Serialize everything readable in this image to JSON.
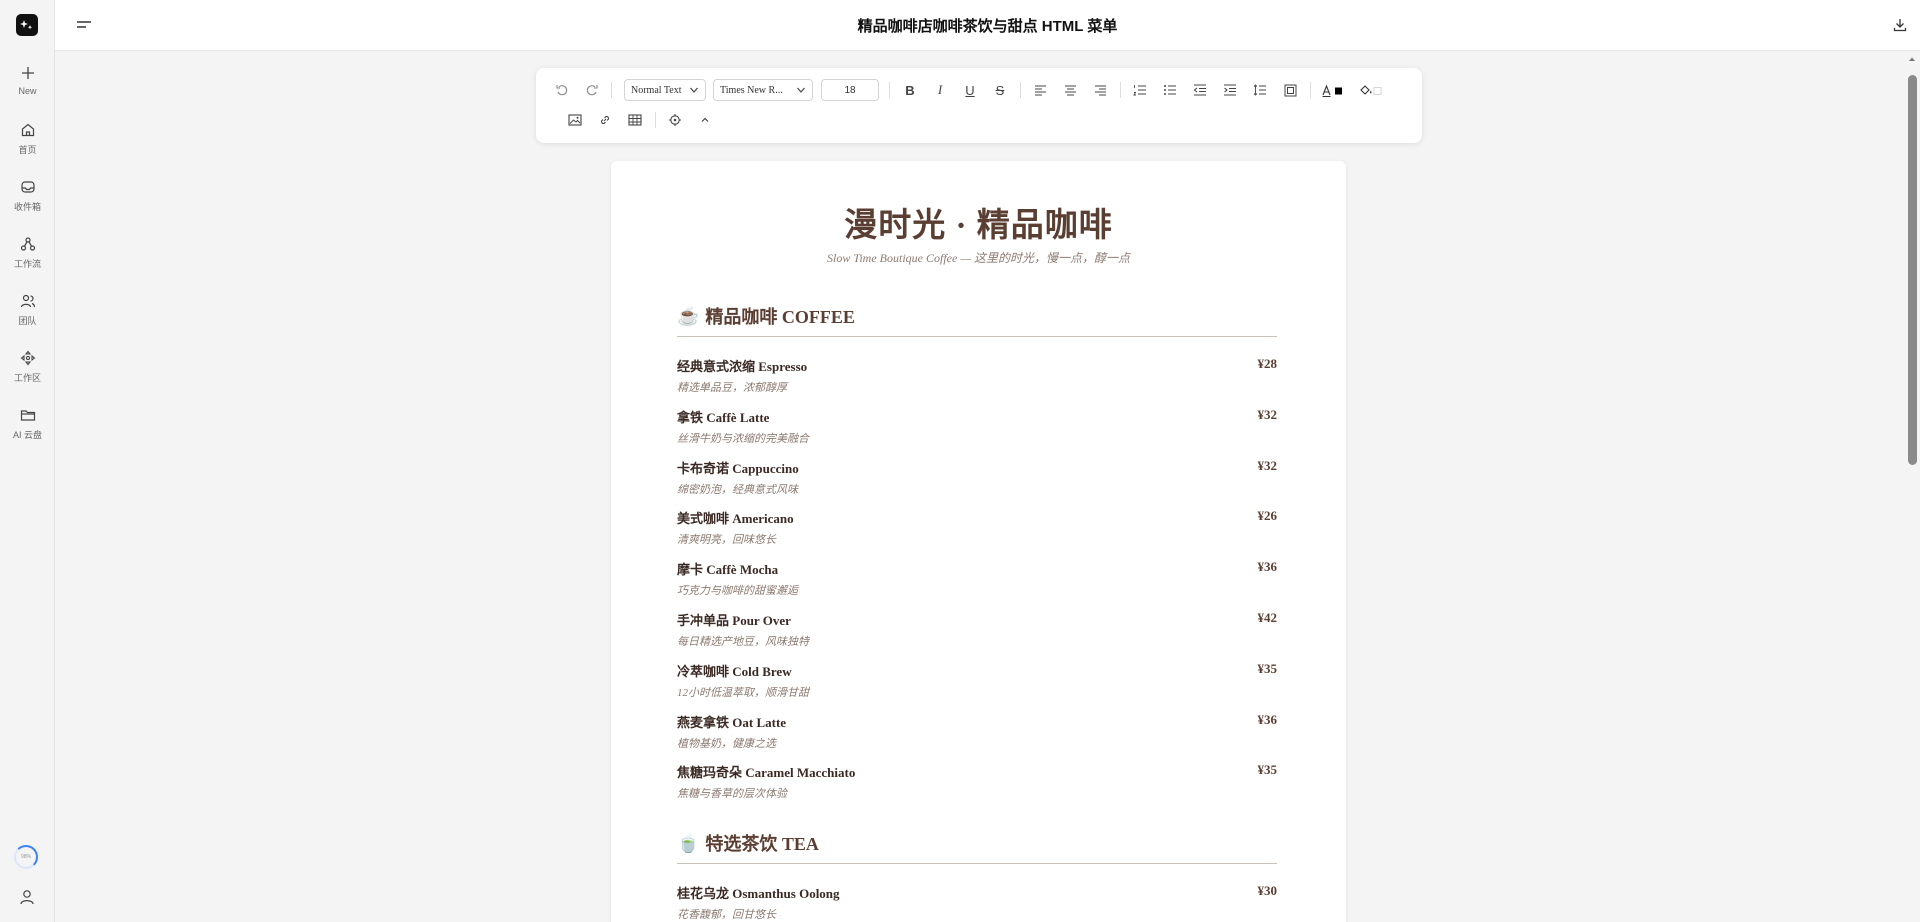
{
  "sidebar": {
    "items": [
      {
        "label": "New"
      },
      {
        "label": "首页"
      },
      {
        "label": "收件箱"
      },
      {
        "label": "工作流"
      },
      {
        "label": "团队"
      },
      {
        "label": "工作区"
      },
      {
        "label": "AI 云盘"
      }
    ],
    "progress": "98%"
  },
  "header": {
    "title": "精品咖啡店咖啡茶饮与甜点 HTML 菜单"
  },
  "toolbar": {
    "paragraph_style": "Normal Text",
    "font_family": "Times New R...",
    "font_size": "18"
  },
  "menu": {
    "title": "漫时光 · 精品咖啡",
    "subtitle": "Slow Time Boutique Coffee — 这里的时光，慢一点，醇一点",
    "sections": [
      {
        "emoji": "☕",
        "title": "精品咖啡 COFFEE",
        "items": [
          {
            "name": "经典意式浓缩 Espresso",
            "price": "¥28",
            "desc": "精选单品豆，浓郁醇厚"
          },
          {
            "name": "拿铁 Caffè Latte",
            "price": "¥32",
            "desc": "丝滑牛奶与浓缩的完美融合"
          },
          {
            "name": "卡布奇诺 Cappuccino",
            "price": "¥32",
            "desc": "绵密奶泡，经典意式风味"
          },
          {
            "name": "美式咖啡 Americano",
            "price": "¥26",
            "desc": "清爽明亮，回味悠长"
          },
          {
            "name": "摩卡 Caffè Mocha",
            "price": "¥36",
            "desc": "巧克力与咖啡的甜蜜邂逅"
          },
          {
            "name": "手冲单品 Pour Over",
            "price": "¥42",
            "desc": "每日精选产地豆，风味独特"
          },
          {
            "name": "冷萃咖啡 Cold Brew",
            "price": "¥35",
            "desc": "12小时低温萃取，顺滑甘甜"
          },
          {
            "name": "燕麦拿铁 Oat Latte",
            "price": "¥36",
            "desc": "植物基奶，健康之选"
          },
          {
            "name": "焦糖玛奇朵 Caramel Macchiato",
            "price": "¥35",
            "desc": "焦糖与香草的层次体验"
          }
        ]
      },
      {
        "emoji": "🍵",
        "title": "特选茶饮 TEA",
        "items": [
          {
            "name": "桂花乌龙 Osmanthus Oolong",
            "price": "¥30",
            "desc": "花香馥郁，回甘悠长"
          }
        ]
      }
    ]
  }
}
